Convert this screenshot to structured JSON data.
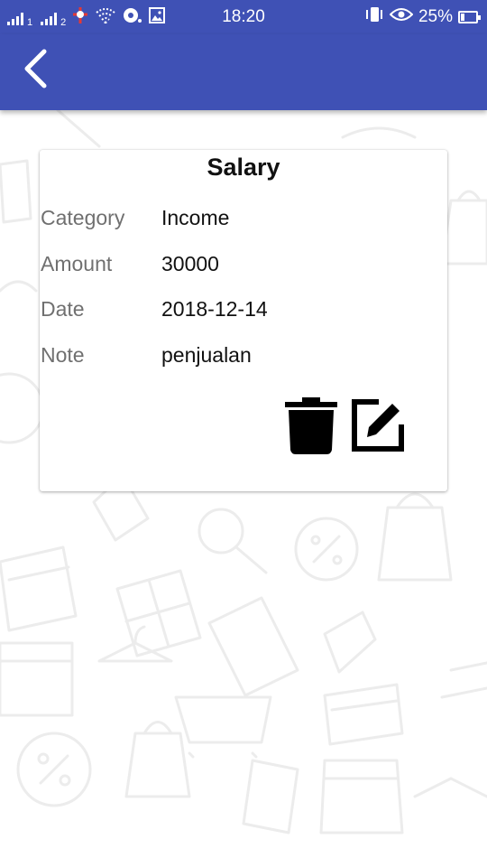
{
  "status_bar": {
    "sim1": "1",
    "sim2": "2",
    "time": "18:20",
    "battery_percent": "25%",
    "battery_level": 0.25
  },
  "app_bar": {
    "back_icon": "chevron-left-icon"
  },
  "card": {
    "title": "Salary",
    "fields": [
      {
        "label": "Category",
        "value": "Income"
      },
      {
        "label": "Amount",
        "value": "30000"
      },
      {
        "label": "Date",
        "value": "2018-12-14"
      },
      {
        "label": "Note",
        "value": "penjualan"
      }
    ],
    "actions": {
      "delete_icon": "trash-icon",
      "edit_icon": "edit-icon"
    }
  },
  "colors": {
    "primary": "#3f51b5",
    "background": "#ffffff",
    "label": "#707070",
    "value": "#111111"
  }
}
